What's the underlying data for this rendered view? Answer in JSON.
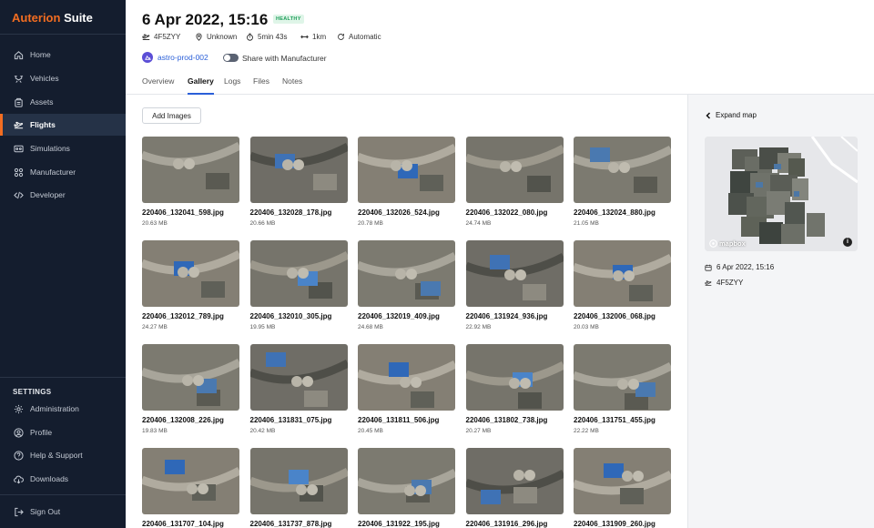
{
  "app": {
    "brand": "Auterion",
    "suite": "Suite"
  },
  "sidebar": {
    "items": [
      {
        "label": "Home",
        "icon": "home-icon"
      },
      {
        "label": "Vehicles",
        "icon": "drone-icon"
      },
      {
        "label": "Assets",
        "icon": "assets-icon"
      },
      {
        "label": "Flights",
        "icon": "flight-icon",
        "active": true
      },
      {
        "label": "Simulations",
        "icon": "simulation-icon"
      },
      {
        "label": "Manufacturer",
        "icon": "manufacturer-icon"
      },
      {
        "label": "Developer",
        "icon": "code-icon"
      }
    ],
    "settings_heading": "SETTINGS",
    "settings_items": [
      {
        "label": "Administration",
        "icon": "gear-icon"
      },
      {
        "label": "Profile",
        "icon": "profile-icon"
      },
      {
        "label": "Help & Support",
        "icon": "help-icon"
      },
      {
        "label": "Downloads",
        "icon": "cloud-download-icon"
      }
    ],
    "sign_out": "Sign Out"
  },
  "header": {
    "title": "6 Apr 2022, 15:16",
    "status_badge": "HEALTHY",
    "meta": {
      "vehicle": "4F5ZYY",
      "location": "Unknown",
      "duration": "5min 43s",
      "distance": "1km",
      "mode": "Automatic"
    },
    "team": "astro-prod-002",
    "share_label": "Share with Manufacturer",
    "share_enabled": false
  },
  "tabs": [
    {
      "label": "Overview"
    },
    {
      "label": "Gallery",
      "active": true
    },
    {
      "label": "Logs"
    },
    {
      "label": "Files"
    },
    {
      "label": "Notes"
    }
  ],
  "gallery": {
    "add_button": "Add Images",
    "images": [
      {
        "name": "220406_132041_598.jpg",
        "size": "20.63 MB"
      },
      {
        "name": "220406_132028_178.jpg",
        "size": "20.66 MB"
      },
      {
        "name": "220406_132026_524.jpg",
        "size": "20.78 MB"
      },
      {
        "name": "220406_132022_080.jpg",
        "size": "24.74 MB"
      },
      {
        "name": "220406_132024_880.jpg",
        "size": "21.05 MB"
      },
      {
        "name": "220406_132012_789.jpg",
        "size": "24.27 MB"
      },
      {
        "name": "220406_132010_305.jpg",
        "size": "19.95 MB"
      },
      {
        "name": "220406_132019_409.jpg",
        "size": "24.68 MB"
      },
      {
        "name": "220406_131924_936.jpg",
        "size": "22.92 MB"
      },
      {
        "name": "220406_132006_068.jpg",
        "size": "20.03 MB"
      },
      {
        "name": "220406_132008_226.jpg",
        "size": "19.83 MB"
      },
      {
        "name": "220406_131831_075.jpg",
        "size": "20.42 MB"
      },
      {
        "name": "220406_131811_506.jpg",
        "size": "20.45 MB"
      },
      {
        "name": "220406_131802_738.jpg",
        "size": "20.27 MB"
      },
      {
        "name": "220406_131751_455.jpg",
        "size": "22.22 MB"
      },
      {
        "name": "220406_131707_104.jpg",
        "size": ""
      },
      {
        "name": "220406_131737_878.jpg",
        "size": ""
      },
      {
        "name": "220406_131922_195.jpg",
        "size": ""
      },
      {
        "name": "220406_131916_296.jpg",
        "size": ""
      },
      {
        "name": "220406_131909_260.jpg",
        "size": ""
      }
    ]
  },
  "side_panel": {
    "expand_label": "Expand map",
    "map_attribution": "mapbox",
    "date": "6 Apr 2022, 15:16",
    "vehicle": "4F5ZYY"
  },
  "colors": {
    "sidebar_bg": "#141d2e",
    "accent": "#f36d21",
    "link": "#2a5fd8",
    "healthy": "#1e9e5a"
  }
}
